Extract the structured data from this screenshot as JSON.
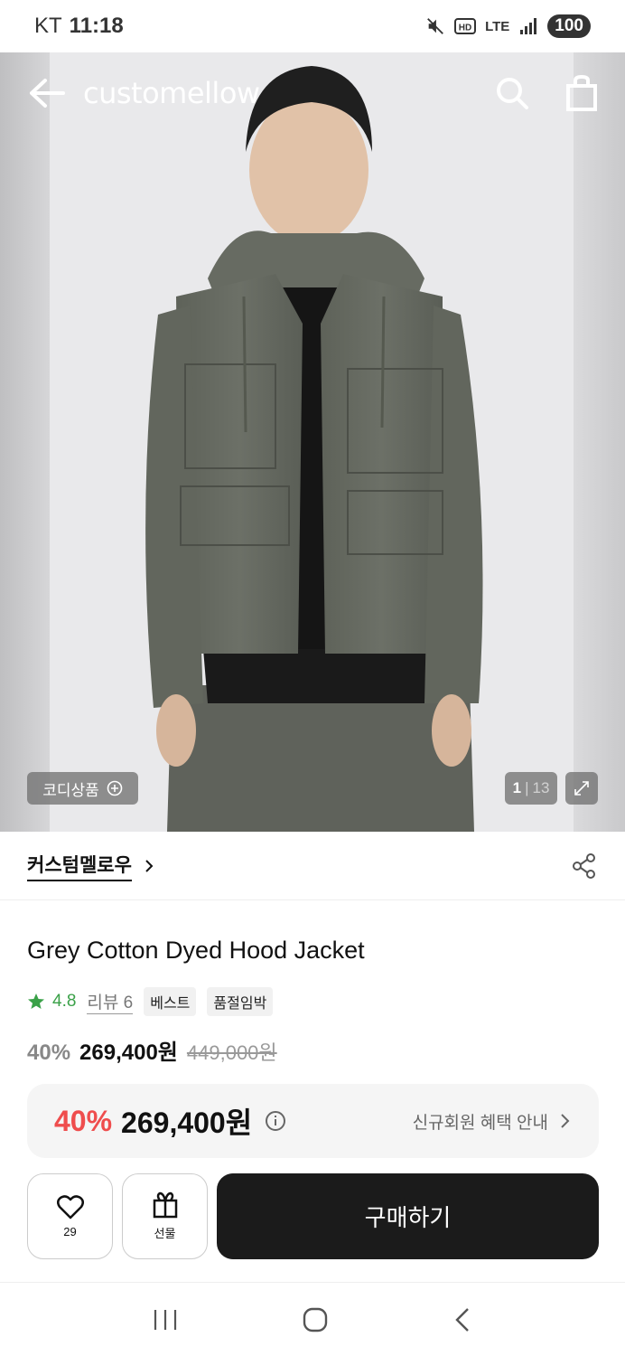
{
  "status_bar": {
    "carrier": "KT",
    "time": "11:18",
    "network": "LTE",
    "battery": "100",
    "icons": [
      "mute-icon",
      "hd-icon",
      "lte-icon",
      "signal-icon",
      "battery-icon"
    ]
  },
  "header": {
    "logo": "customellow",
    "icons": [
      "back-arrow-icon",
      "search-icon",
      "shopping-bag-icon"
    ]
  },
  "gallery": {
    "codi_label": "코디상품",
    "codi_icon": "plus-circle-icon",
    "current_index": "1",
    "total_count": "13",
    "expand_icon": "expand-icon"
  },
  "brand": {
    "name": "커스텀멜로우",
    "chevron_icon": "chevron-right-icon",
    "share_icon": "share-icon"
  },
  "product": {
    "title": "Grey Cotton Dyed Hood Jacket",
    "rating": "4.8",
    "review_label": "리뷰 6",
    "badges": [
      "베스트",
      "품절임박"
    ],
    "discount": "40%",
    "sale_price": "269,400원",
    "original_price": "449,000원"
  },
  "member_price": {
    "discount": "40%",
    "price": "269,400원",
    "link_label": "신규회원 혜택 안내"
  },
  "actions": {
    "like_count": "29",
    "gift_label": "선물",
    "buy_label": "구매하기"
  },
  "colors": {
    "accent_red": "#ef4d4d",
    "rating_green": "#3aa148",
    "buy_button": "#1b1b1b"
  },
  "navbar": {
    "icons": [
      "recent-apps-icon",
      "home-icon",
      "back-icon"
    ]
  }
}
